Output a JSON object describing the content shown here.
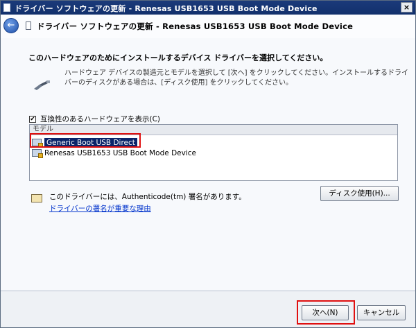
{
  "window": {
    "title": "ドライバー ソフトウェアの更新 - Renesas USB1653 USB Boot Mode Device",
    "close_label": "×"
  },
  "header": {
    "back_label": "←",
    "title": "ドライバー ソフトウェアの更新 - Renesas USB1653 USB Boot Mode Device"
  },
  "content": {
    "instruction": "このハードウェアのためにインストールするデバイス ドライバーを選択してください。",
    "description": "ハードウェア デバイスの製造元とモデルを選択して [次へ] をクリックしてください。インストールするドライバーのディスクがある場合は、[ディスク使用] をクリックしてください。",
    "compat_checkbox": {
      "checked": true,
      "mark": "✔",
      "label": "互換性のあるハードウェアを表示(C)"
    },
    "model_list": {
      "header": "モデル",
      "items": [
        {
          "label": "Generic Boot USB Direct",
          "selected": true
        },
        {
          "label": "Renesas USB1653 USB Boot Mode Device",
          "selected": false
        }
      ]
    },
    "signature": {
      "text": "このドライバーには、Authenticode(tm) 署名があります。",
      "link": "ドライバーの署名が重要な理由"
    },
    "disk_button": "ディスク使用(H)..."
  },
  "footer": {
    "next_button": "次へ(N)",
    "cancel_button": "キャンセル"
  },
  "colors": {
    "title_bar": "#12306c",
    "selection": "#0a246a",
    "highlight": "#e01010",
    "link": "#0033cc"
  }
}
